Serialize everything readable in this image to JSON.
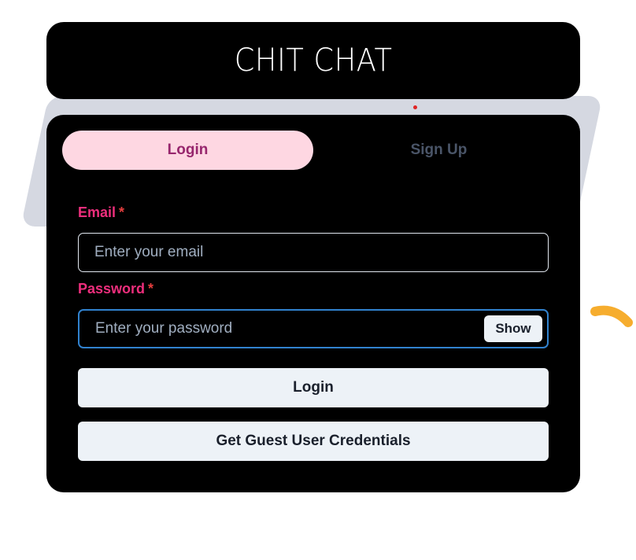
{
  "app": {
    "title": "CHIT CHAT"
  },
  "tabs": [
    {
      "label": "Login",
      "active": true
    },
    {
      "label": "Sign Up",
      "active": false
    }
  ],
  "form": {
    "email": {
      "label": "Email",
      "required_marker": "*",
      "placeholder": "Enter your email",
      "value": ""
    },
    "password": {
      "label": "Password",
      "required_marker": "*",
      "placeholder": "Enter your password",
      "value": "",
      "toggle_label": "Show"
    },
    "submit_label": "Login",
    "guest_label": "Get Guest User Credentials"
  },
  "colors": {
    "card_background": "#000000",
    "active_tab_background": "#fed7e2",
    "active_tab_text": "#97266d",
    "label_color": "#ed2e7c",
    "required_color": "#e53e3e",
    "focus_border": "#3182ce",
    "button_background": "#edf2f7",
    "background_slab": "#d5d8e1",
    "accent_arc": "#f6ad2e"
  }
}
